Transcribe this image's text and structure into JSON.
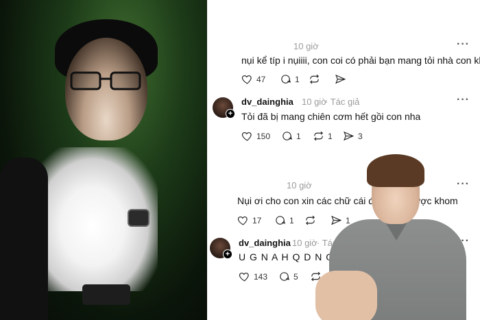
{
  "comments": [
    {
      "time": "10 giờ",
      "text": "nụi kể típ i nụiiii, con coi có phải bạn mang tỏi nhà con kh",
      "likes": "47",
      "replies": "1"
    },
    {
      "username": "dv_dainghia",
      "time": "10 giờ",
      "author_tag": "· Tác giả",
      "text": "Tỏi đã bị mang chiên cơm hết gồi con nha",
      "likes": "150",
      "replies": "1",
      "reposts": "1",
      "shares": "3"
    },
    {
      "time": "10 giờ",
      "text": "Nụi ơi cho con xin các chữ cái đầu t",
      "text_tail": "ược khom",
      "likes": "17",
      "replies": "1",
      "shares": "1"
    },
    {
      "username": "dv_dainghia",
      "time": "10 giờ",
      "author_tag": "· Tác",
      "text": "U G N A H Q D N O O",
      "likes": "143",
      "replies": "5"
    }
  ],
  "icons": {
    "like": "heart-icon",
    "reply": "comment-icon",
    "repost": "repost-icon",
    "share": "send-icon",
    "more": "more-icon"
  },
  "more_glyph": "···"
}
